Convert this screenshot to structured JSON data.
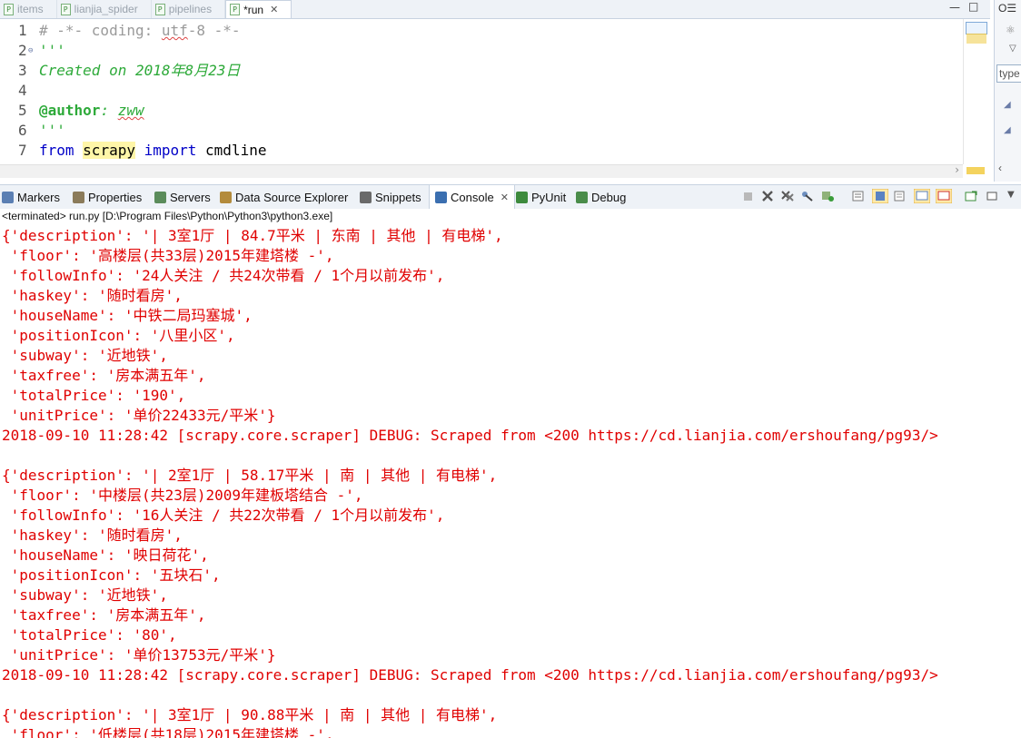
{
  "editor_tabs": [
    {
      "label": "items",
      "icon": "python-file-icon",
      "active": false
    },
    {
      "label": "lianjia_spider",
      "icon": "python-file-icon",
      "active": false
    },
    {
      "label": "pipelines",
      "icon": "python-file-icon",
      "active": false
    },
    {
      "label": "*run",
      "icon": "python-file-icon",
      "active": true
    }
  ],
  "editor": {
    "lines": [
      {
        "n": "1",
        "segments": [
          {
            "t": "# -*- coding: ",
            "c": "c-comment"
          },
          {
            "t": "utf",
            "c": "c-comment squiggle"
          },
          {
            "t": "-8 -*-",
            "c": "c-comment"
          }
        ]
      },
      {
        "n": "2",
        "fold": true,
        "segments": [
          {
            "t": "'''",
            "c": "c-string"
          }
        ]
      },
      {
        "n": "3",
        "segments": [
          {
            "t": "Created on 2018年8月23日",
            "c": "c-italic-green"
          }
        ]
      },
      {
        "n": "4",
        "segments": []
      },
      {
        "n": "5",
        "segments": [
          {
            "t": "@author",
            "c": "c-deco"
          },
          {
            "t": ": ",
            "c": "c-italic-green"
          },
          {
            "t": "zww",
            "c": "c-italic-green squiggle"
          }
        ]
      },
      {
        "n": "6",
        "segments": [
          {
            "t": "'''",
            "c": "c-string"
          }
        ]
      },
      {
        "n": "7",
        "segments": [
          {
            "t": "from",
            "c": "c-keyword"
          },
          {
            "t": " ",
            "c": "c-default"
          },
          {
            "t": "scrapy",
            "c": "c-default hl-yellow"
          },
          {
            "t": " ",
            "c": "c-default"
          },
          {
            "t": "import",
            "c": "c-keyword"
          },
          {
            "t": " cmdline",
            "c": "c-default"
          }
        ]
      }
    ]
  },
  "outline": {
    "tab_label": "O☰",
    "filter_placeholder": "type"
  },
  "view_tabs": [
    {
      "label": "Markers",
      "icon": "markers-icon"
    },
    {
      "label": "Properties",
      "icon": "properties-icon"
    },
    {
      "label": "Servers",
      "icon": "servers-icon"
    },
    {
      "label": "Data Source Explorer",
      "icon": "database-icon"
    },
    {
      "label": "Snippets",
      "icon": "snippets-icon"
    },
    {
      "label": "Console",
      "icon": "console-icon",
      "active": true
    },
    {
      "label": "PyUnit",
      "icon": "pyunit-icon"
    },
    {
      "label": "Debug",
      "icon": "debug-icon"
    }
  ],
  "console": {
    "status": "<terminated> run.py [D:\\Program Files\\Python\\Python3\\python3.exe]",
    "lines": [
      "{'description': '| 3室1厅 | 84.7平米 | 东南 | 其他 | 有电梯',",
      " 'floor': '高楼层(共33层)2015年建塔楼 -',",
      " 'followInfo': '24人关注 / 共24次带看 / 1个月以前发布',",
      " 'haskey': '随时看房',",
      " 'houseName': '中铁二局玛塞城',",
      " 'positionIcon': '八里小区',",
      " 'subway': '近地铁',",
      " 'taxfree': '房本满五年',",
      " 'totalPrice': '190',",
      " 'unitPrice': '单价22433元/平米'}",
      "2018-09-10 11:28:42 [scrapy.core.scraper] DEBUG: Scraped from <200 https://cd.lianjia.com/ershoufang/pg93/>",
      "",
      "{'description': '| 2室1厅 | 58.17平米 | 南 | 其他 | 有电梯',",
      " 'floor': '中楼层(共23层)2009年建板塔结合 -',",
      " 'followInfo': '16人关注 / 共22次带看 / 1个月以前发布',",
      " 'haskey': '随时看房',",
      " 'houseName': '映日荷花',",
      " 'positionIcon': '五块石',",
      " 'subway': '近地铁',",
      " 'taxfree': '房本满五年',",
      " 'totalPrice': '80',",
      " 'unitPrice': '单价13753元/平米'}",
      "2018-09-10 11:28:42 [scrapy.core.scraper] DEBUG: Scraped from <200 https://cd.lianjia.com/ershoufang/pg93/>",
      "",
      "{'description': '| 3室1厅 | 90.88平米 | 南 | 其他 | 有电梯',",
      " 'floor': '低楼层(共18层)2015年建塔楼 -',"
    ]
  },
  "colors": {
    "console_text": "#e00000",
    "keyword": "#0000c8",
    "string": "#2eaa3a",
    "comment": "#9a9a9a",
    "tab_bar": "#eef2f7"
  }
}
